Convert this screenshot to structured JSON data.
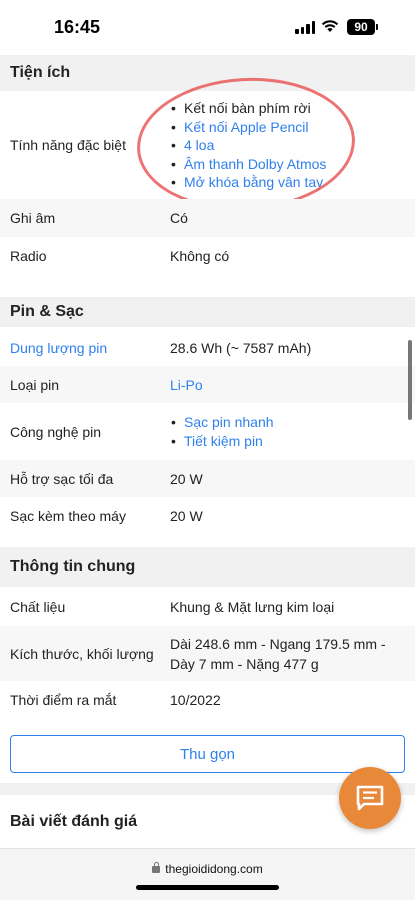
{
  "status": {
    "time": "16:45",
    "battery": "90"
  },
  "sections": {
    "tien_ich": {
      "title": "Tiện ích",
      "special_features_label": "Tính năng đặc biệt",
      "special_features": [
        "Kết nối bàn phím rời",
        "Kết nối Apple Pencil",
        "4 loa",
        "Âm thanh Dolby Atmos",
        "Mở khóa bằng vân tay"
      ],
      "recording_label": "Ghi âm",
      "recording_value": "Có",
      "radio_label": "Radio",
      "radio_value": "Không có"
    },
    "pin_sac": {
      "title": "Pin & Sạc",
      "capacity_label": "Dung lượng pin",
      "capacity_value": "28.6 Wh (~ 7587 mAh)",
      "type_label": "Loại pin",
      "type_value": "Li-Po",
      "tech_label": "Công nghệ pin",
      "tech_values": [
        "Sạc pin nhanh",
        "Tiết kiệm pin"
      ],
      "max_charge_label": "Hỗ trợ sạc tối đa",
      "max_charge_value": "20 W",
      "included_charger_label": "Sạc kèm theo máy",
      "included_charger_value": "20 W"
    },
    "thong_tin_chung": {
      "title": "Thông tin chung",
      "material_label": "Chất liệu",
      "material_value": "Khung & Mặt lưng kim loại",
      "size_label": "Kích thước, khối lượng",
      "size_value": "Dài 248.6 mm - Ngang 179.5 mm - Dày 7 mm - Nặng 477 g",
      "release_label": "Thời điểm ra mắt",
      "release_value": "10/2022"
    }
  },
  "collapse_button": "Thu gọn",
  "review_title": "Bài viết đánh giá",
  "browser": {
    "url": "thegioididong.com"
  },
  "icons": {
    "chat": "chat-bubble-icon",
    "lock": "lock-icon"
  },
  "colors": {
    "accent": "#2f80ed",
    "fab": "#e8893a",
    "mark": "#e85a5a"
  }
}
